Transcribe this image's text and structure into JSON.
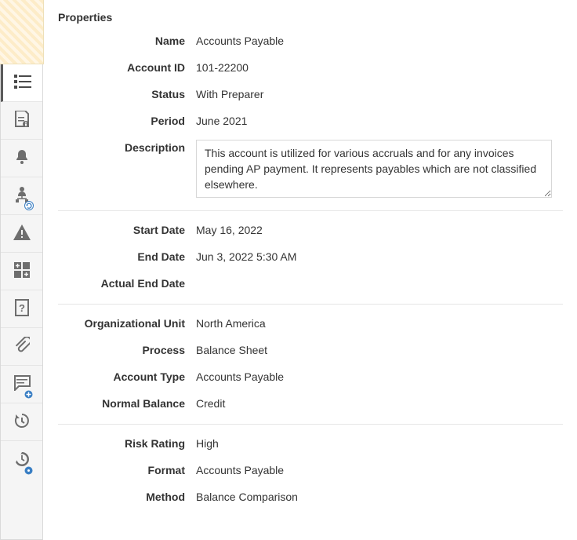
{
  "panel_title": "Properties",
  "fields": {
    "name": {
      "label": "Name",
      "value": "Accounts Payable"
    },
    "account_id": {
      "label": "Account ID",
      "value": "101-22200"
    },
    "status": {
      "label": "Status",
      "value": "With Preparer"
    },
    "period": {
      "label": "Period",
      "value": "June 2021"
    },
    "description": {
      "label": "Description",
      "value": "This account is utilized for various accruals and for any invoices pending AP payment. It represents payables which are not classified elsewhere."
    },
    "start_date": {
      "label": "Start Date",
      "value": "May 16, 2022"
    },
    "end_date": {
      "label": "End Date",
      "value": "Jun 3, 2022 5:30 AM"
    },
    "actual_end_date": {
      "label": "Actual End Date",
      "value": ""
    },
    "org_unit": {
      "label": "Organizational Unit",
      "value": "North America"
    },
    "process": {
      "label": "Process",
      "value": "Balance Sheet"
    },
    "account_type": {
      "label": "Account Type",
      "value": "Accounts Payable"
    },
    "normal_balance": {
      "label": "Normal Balance",
      "value": "Credit"
    },
    "risk_rating": {
      "label": "Risk Rating",
      "value": "High"
    },
    "format": {
      "label": "Format",
      "value": "Accounts Payable"
    },
    "method": {
      "label": "Method",
      "value": "Balance Comparison"
    }
  },
  "nav": {
    "items": [
      {
        "name": "properties",
        "selected": true
      },
      {
        "name": "instructions",
        "selected": false
      },
      {
        "name": "alerts",
        "selected": false
      },
      {
        "name": "workflow",
        "selected": false
      },
      {
        "name": "warnings",
        "selected": false
      },
      {
        "name": "attributes",
        "selected": false
      },
      {
        "name": "questions",
        "selected": false
      },
      {
        "name": "attachments",
        "selected": false
      },
      {
        "name": "comments",
        "selected": false
      },
      {
        "name": "history",
        "selected": false
      },
      {
        "name": "timing",
        "selected": false
      }
    ]
  }
}
